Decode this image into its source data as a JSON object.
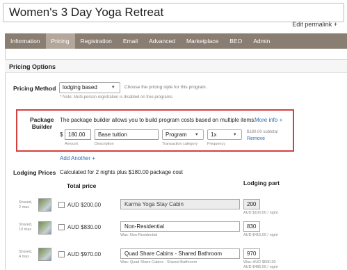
{
  "page": {
    "title_value": "Women's 3 Day Yoga Retreat",
    "edit_permalink": "Edit permalink +"
  },
  "tabs": [
    {
      "label": "Information",
      "active": false
    },
    {
      "label": "Pricing",
      "active": true
    },
    {
      "label": "Registration",
      "active": false
    },
    {
      "label": "Email",
      "active": false
    },
    {
      "label": "Advanced",
      "active": false
    },
    {
      "label": "Marketplace",
      "active": false
    },
    {
      "label": "BEO",
      "active": false
    },
    {
      "label": "Admin",
      "active": false
    }
  ],
  "pricing": {
    "header": "Pricing Options",
    "method_label": "Pricing Method",
    "method_value": "lodging based",
    "method_help": "Choose the pricing style for this program.",
    "method_note": "* Note: Multi-person registration is disabled on free programs."
  },
  "package": {
    "label_line1": "Package",
    "label_line2": "Builder",
    "description": "The package builder allows you to build program costs based on multiple items.",
    "more_info": "More info +",
    "currency_symbol": "$",
    "amount_value": "180.00",
    "amount_label": "Amount",
    "description_value": "Base tuition",
    "description_label": "Description",
    "category_value": "Program",
    "category_label": "Transaction category",
    "frequency_value": "1x",
    "frequency_label": "Frequency",
    "subtotal": "$180.00 subtotal",
    "remove": "Remove",
    "add_another": "Add Another +"
  },
  "lodging": {
    "label": "Lodging Prices",
    "calc_text": "Calculated for 2 nights plus $180.00 package cost",
    "total_price_header": "Total price",
    "lodging_part_header": "Lodging part",
    "rows": [
      {
        "occupancy": "Shared, 2 max",
        "price": "AUD $200.00",
        "cabin": "Karma Yoga Stay Cabin",
        "cabin_disabled": true,
        "was": "",
        "part": "200",
        "part_disabled": true,
        "part_sub": "AUD $100.00 / night"
      },
      {
        "occupancy": "Shared, 10 max",
        "price": "AUD $830.00",
        "cabin": "Non-Residential",
        "cabin_disabled": false,
        "was": "Was: Non-Residential",
        "part": "830",
        "part_disabled": false,
        "part_sub": "AUD $415.00 / night"
      },
      {
        "occupancy": "Shared, 4 max",
        "price": "AUD $970.00",
        "cabin": "Quad Share Cabins - Shared Bathroom",
        "cabin_disabled": false,
        "was": "Was: Quad Share Cabins - Shared Bathroom",
        "part": "970",
        "part_disabled": false,
        "part_sub": "Was: AUD $590.00",
        "part_sub2": "AUD $485.00 / night"
      }
    ]
  }
}
